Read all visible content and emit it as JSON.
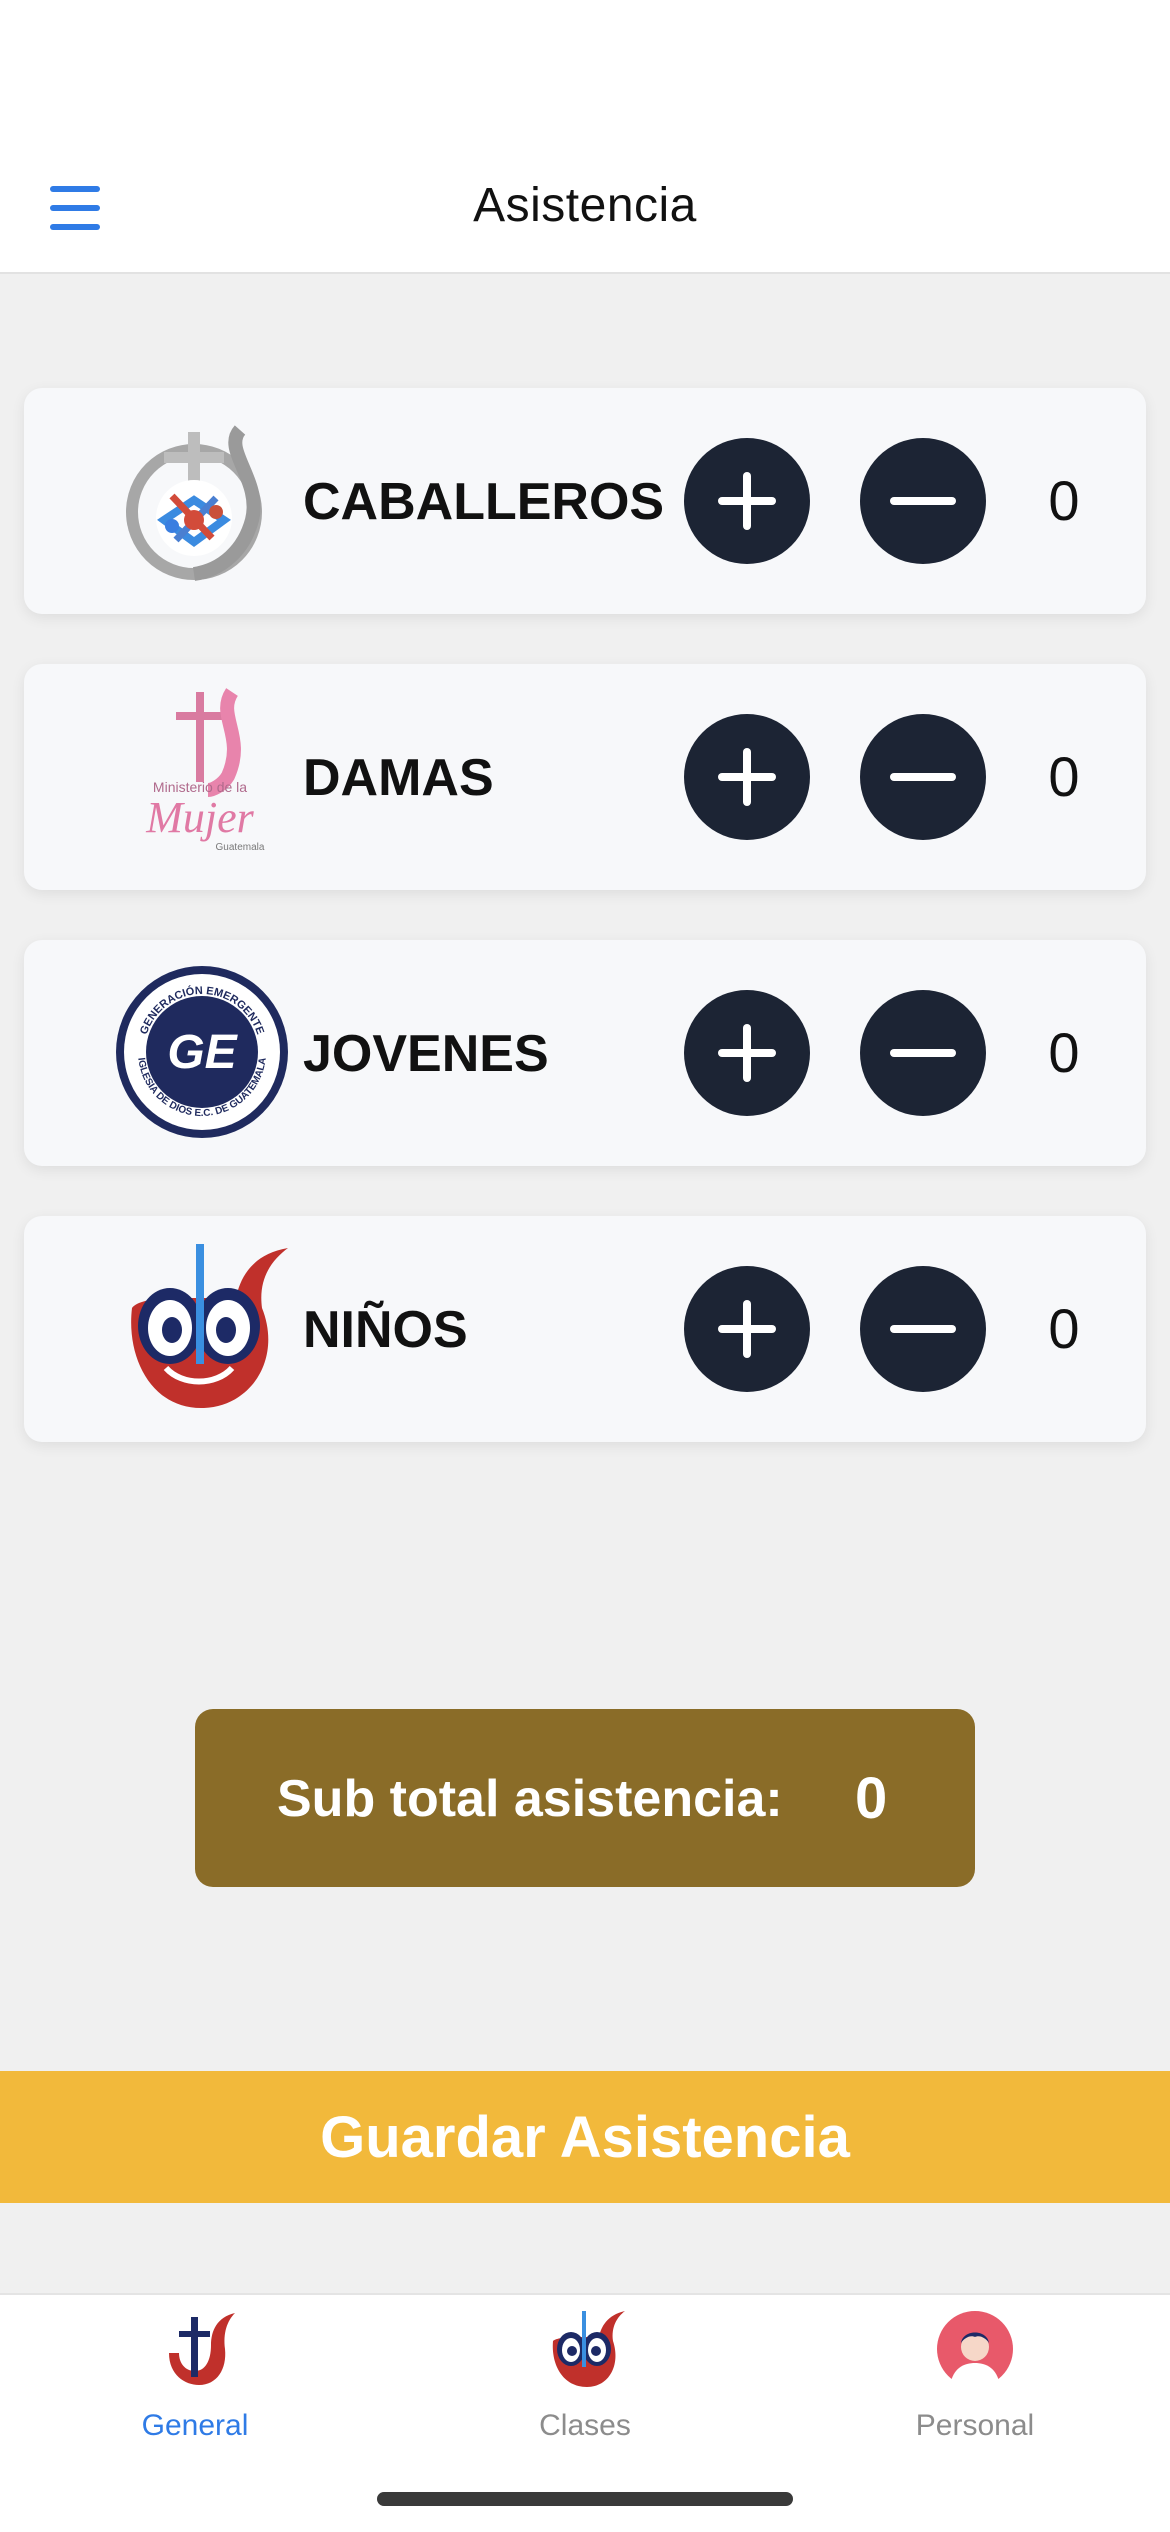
{
  "header": {
    "title": "Asistencia",
    "menu_icon": "hamburger-menu-icon",
    "accent_color": "#2f7be6"
  },
  "groups": [
    {
      "label": "CABALLEROS",
      "count": "0",
      "logo": "caballeros-ministry-logo"
    },
    {
      "label": "DAMAS",
      "count": "0",
      "logo": "ministerio-de-la-mujer-logo",
      "logo_text": [
        "Ministerio de la",
        "Mujer",
        "Guatemala"
      ]
    },
    {
      "label": "JOVENES",
      "count": "0",
      "logo": "generacion-emergente-logo",
      "logo_text": [
        "GENERACIÓN EMERGENTE",
        "IGLESIA DE DIOS E.C. DE GUATEMALA",
        "GE"
      ]
    },
    {
      "label": "NIÑOS",
      "count": "0",
      "logo": "ninos-owl-logo"
    }
  ],
  "controls": {
    "increment_icon": "plus-icon",
    "decrement_icon": "minus-icon",
    "button_color": "#1c2434"
  },
  "subtotal": {
    "label": "Sub total asistencia:",
    "value": "0",
    "color": "#8a6c28"
  },
  "save_button": {
    "label": "Guardar Asistencia",
    "color": "#f2b93b"
  },
  "tabs": [
    {
      "label": "General",
      "icon": "church-logo-icon",
      "active": true
    },
    {
      "label": "Clases",
      "icon": "owl-logo-icon",
      "active": false
    },
    {
      "label": "Personal",
      "icon": "user-avatar-icon",
      "active": false
    }
  ]
}
